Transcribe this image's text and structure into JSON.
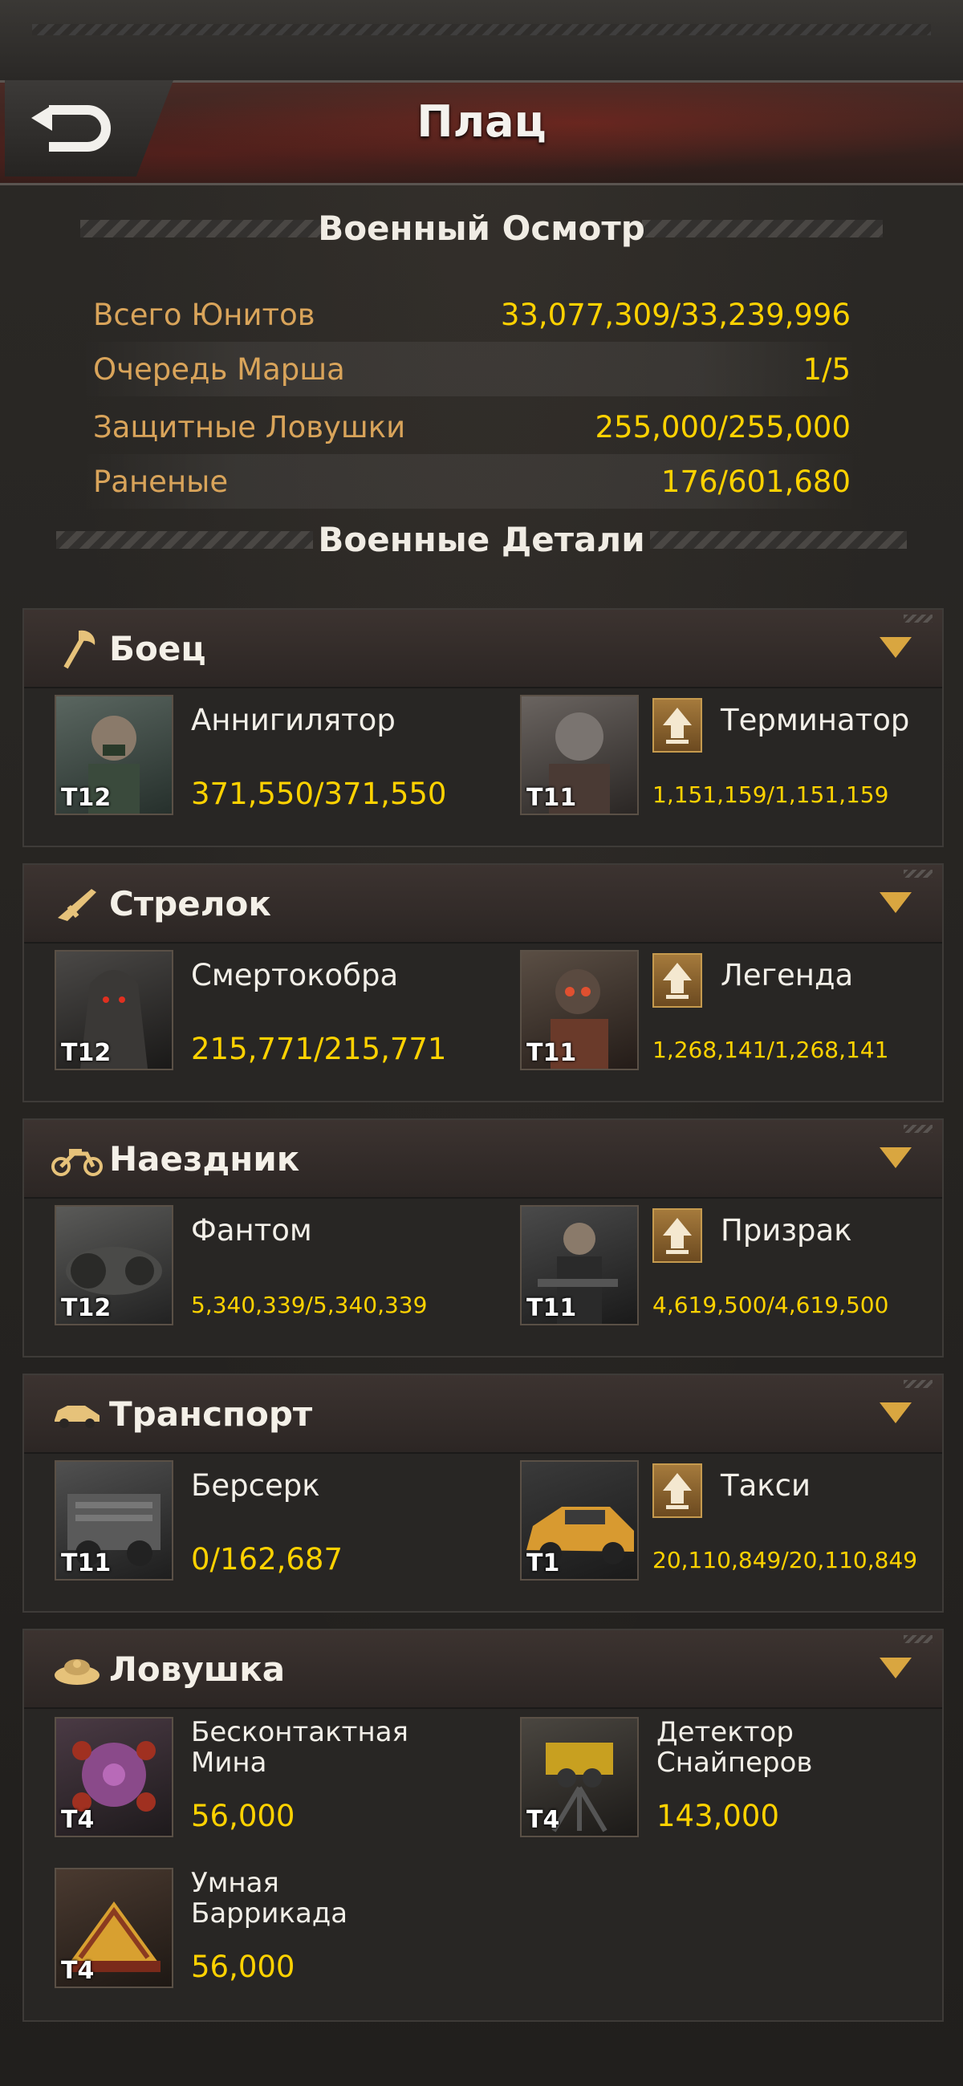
{
  "header": {
    "title": "Плац"
  },
  "overview": {
    "heading": "Военный Осмотр",
    "stats": [
      {
        "label": "Всего Юнитов",
        "value": "33,077,309/33,239,996"
      },
      {
        "label": "Очередь Марша",
        "value": "1/5"
      },
      {
        "label": "Защитные Ловушки",
        "value": "255,000/255,000"
      },
      {
        "label": "Раненые",
        "value": "176/601,680"
      }
    ]
  },
  "details": {
    "heading": "Военные Детали",
    "categories": [
      {
        "label": "Боец",
        "icon": "axe-icon",
        "units": [
          {
            "name": "Аннигилятор",
            "tier": "T12",
            "count": "371,550/371,550"
          },
          {
            "name": "Терминатор",
            "tier": "T11",
            "count": "1,151,159/1,151,159",
            "upgrade": true
          }
        ]
      },
      {
        "label": "Стрелок",
        "icon": "rifle-icon",
        "units": [
          {
            "name": "Смертокобра",
            "tier": "T12",
            "count": "215,771/215,771"
          },
          {
            "name": "Легенда",
            "tier": "T11",
            "count": "1,268,141/1,268,141",
            "upgrade": true
          }
        ]
      },
      {
        "label": "Наездник",
        "icon": "motorcycle-icon",
        "units": [
          {
            "name": "Фантом",
            "tier": "T12",
            "count": "5,340,339/5,340,339"
          },
          {
            "name": "Призрак",
            "tier": "T11",
            "count": "4,619,500/4,619,500",
            "upgrade": true
          }
        ]
      },
      {
        "label": "Транспорт",
        "icon": "car-icon",
        "units": [
          {
            "name": "Берсерк",
            "tier": "T11",
            "count": "0/162,687"
          },
          {
            "name": "Такси",
            "tier": "T1",
            "count": "20,110,849/20,110,849",
            "upgrade": true
          }
        ]
      },
      {
        "label": "Ловушка",
        "icon": "mine-icon",
        "units": [
          {
            "name": "Бесконтактная Мина",
            "tier": "T4",
            "count": "56,000"
          },
          {
            "name": "Детектор Снайперов",
            "tier": "T4",
            "count": "143,000"
          },
          {
            "name": "Умная Баррикада",
            "tier": "T4",
            "count": "56,000"
          }
        ]
      }
    ]
  },
  "colors": {
    "accent": "#ffd200",
    "label": "#d9a45a",
    "arrow": "#d9a640"
  }
}
